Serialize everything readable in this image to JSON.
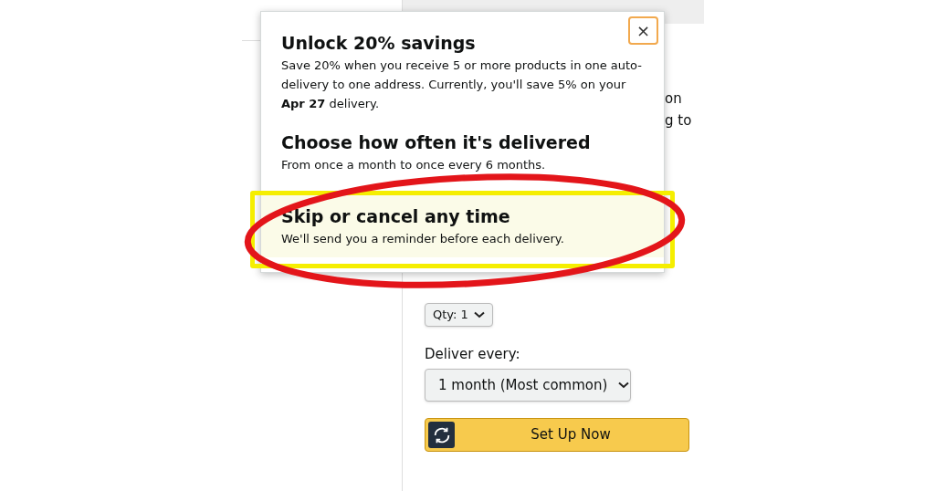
{
  "page": {
    "fragments": [
      "on",
      "g to"
    ],
    "quantity": {
      "label": "Qty:",
      "value": "1"
    },
    "deliver_label": "Deliver every:",
    "frequency": "1 month (Most common)",
    "button": "Set Up Now"
  },
  "popup": {
    "close": "×",
    "sections": [
      {
        "title": "Unlock 20% savings",
        "text": "Save 20% when you receive 5 or more products in one auto-delivery to one address. Currently, you'll save 5% on your **Apr 27** delivery.",
        "highlighted": false
      },
      {
        "title": "Choose how often it's delivered",
        "text": "From once a month to once every 6 months.",
        "highlighted": false
      },
      {
        "title": "Skip or cancel any time",
        "text": "We'll send you a reminder before each delivery.",
        "highlighted": true
      }
    ]
  }
}
